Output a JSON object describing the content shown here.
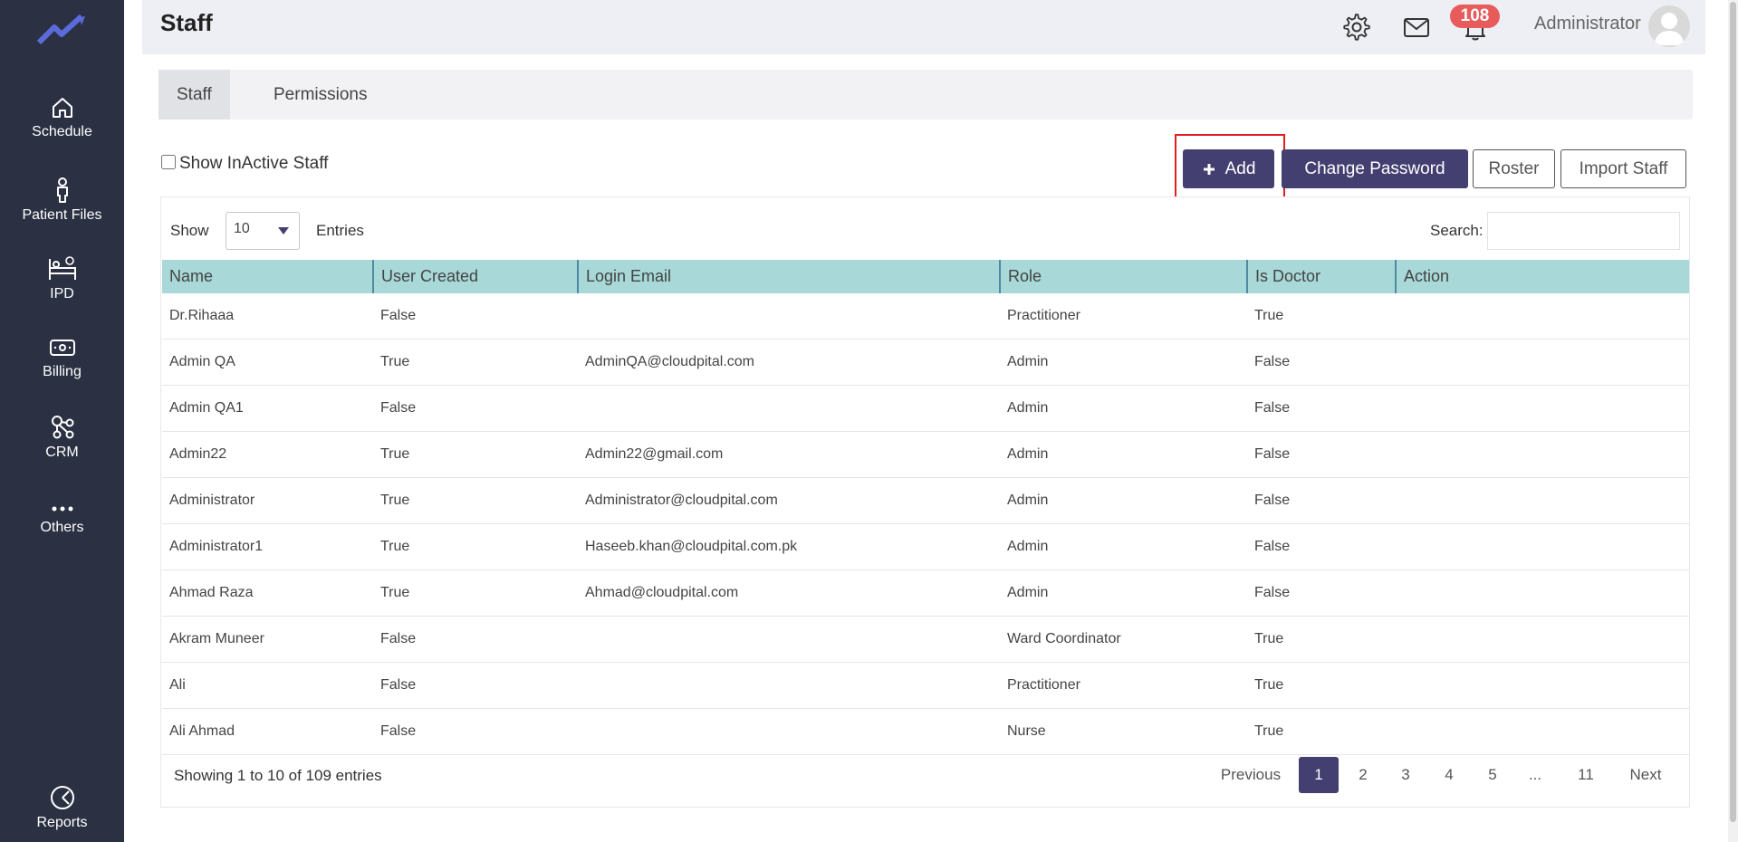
{
  "sidebar": {
    "logo": "trend-logo",
    "items": [
      {
        "label": "Schedule",
        "icon": "home-icon"
      },
      {
        "label": "Patient Files",
        "icon": "person-icon"
      },
      {
        "label": "IPD",
        "icon": "bed-icon"
      },
      {
        "label": "Billing",
        "icon": "cash-icon"
      },
      {
        "label": "CRM",
        "icon": "network-icon"
      },
      {
        "label": "Others",
        "icon": "more-dots-icon"
      },
      {
        "label": "Reports",
        "icon": "pie-chart-icon"
      }
    ]
  },
  "header": {
    "title": "Staff",
    "notification_count": "108",
    "user_name": "Administrator"
  },
  "tabs": [
    {
      "label": "Staff",
      "active": true
    },
    {
      "label": "Permissions",
      "active": false
    }
  ],
  "controls": {
    "show_inactive_label": "Show InActive Staff",
    "add_label": "Add",
    "change_password_label": "Change Password",
    "roster_label": "Roster",
    "import_label": "Import Staff"
  },
  "table": {
    "show_label": "Show",
    "entries_value": "10",
    "entries_label": "Entries",
    "search_label": "Search:",
    "search_value": "",
    "columns": [
      "Name",
      "User Created",
      "Login Email",
      "Role",
      "Is Doctor",
      "Action"
    ],
    "rows": [
      [
        "Dr.Rihaaa",
        "False",
        "",
        "Practitioner",
        "True",
        ""
      ],
      [
        "Admin QA",
        "True",
        "AdminQA@cloudpital.com",
        "Admin",
        "False",
        ""
      ],
      [
        "Admin QA1",
        "False",
        "",
        "Admin",
        "False",
        ""
      ],
      [
        "Admin22",
        "True",
        "Admin22@gmail.com",
        "Admin",
        "False",
        ""
      ],
      [
        "Administrator",
        "True",
        "Administrator@cloudpital.com",
        "Admin",
        "False",
        ""
      ],
      [
        "Administrator1",
        "True",
        "Haseeb.khan@cloudpital.com.pk",
        "Admin",
        "False",
        ""
      ],
      [
        "Ahmad Raza",
        "True",
        "Ahmad@cloudpital.com",
        "Admin",
        "False",
        ""
      ],
      [
        "Akram Muneer",
        "False",
        "",
        "Ward Coordinator",
        "True",
        ""
      ],
      [
        "Ali",
        "False",
        "",
        "Practitioner",
        "True",
        ""
      ],
      [
        "Ali Ahmad",
        "False",
        "",
        "Nurse",
        "True",
        ""
      ]
    ],
    "showing_text": "Showing 1 to 10 of 109 entries"
  },
  "pagination": {
    "previous": "Previous",
    "pages": [
      "1",
      "2",
      "3",
      "4",
      "5",
      "...",
      "11"
    ],
    "current": "1",
    "next": "Next"
  },
  "colors": {
    "sidebar": "#2b3143",
    "primary": "#433f70",
    "table_header": "#a8d8d8",
    "badge": "#e85b5b",
    "highlight": "#e02020"
  }
}
